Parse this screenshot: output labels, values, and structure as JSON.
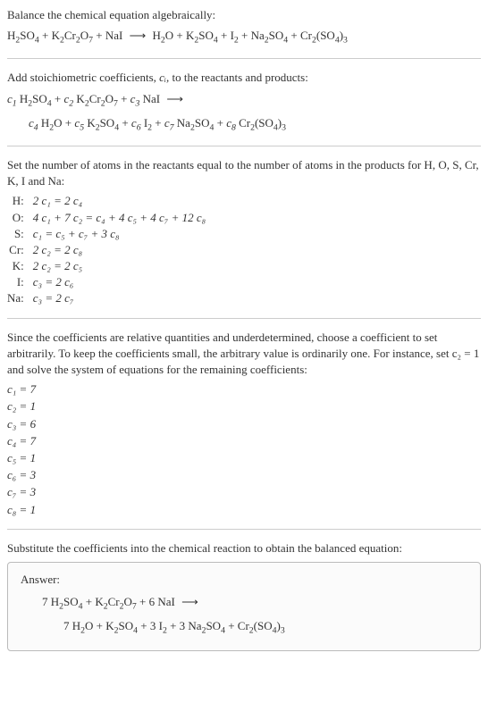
{
  "intro": {
    "line1": "Balance the chemical equation algebraically:"
  },
  "reaction": {
    "lhs": [
      "H₂SO₄",
      "K₂Cr₂O₇",
      "NaI"
    ],
    "rhs": [
      "H₂O",
      "K₂SO₄",
      "I₂",
      "Na₂SO₄",
      "Cr₂(SO₄)₃"
    ]
  },
  "stoich": {
    "text": "Add stoichiometric coefficients, ",
    "text2": ", to the reactants and products:"
  },
  "atoms": {
    "intro": "Set the number of atoms in the reactants equal to the number of atoms in the products for H, O, S, Cr, K, I and Na:",
    "rows": [
      {
        "el": "H:",
        "eq": "2 c₁ = 2 c₄"
      },
      {
        "el": "O:",
        "eq": "4 c₁ + 7 c₂ = c₄ + 4 c₅ + 4 c₇ + 12 c₈"
      },
      {
        "el": "S:",
        "eq": "c₁ = c₅ + c₇ + 3 c₈"
      },
      {
        "el": "Cr:",
        "eq": "2 c₂ = 2 c₈"
      },
      {
        "el": "K:",
        "eq": "2 c₂ = 2 c₅"
      },
      {
        "el": "I:",
        "eq": "c₃ = 2 c₆"
      },
      {
        "el": "Na:",
        "eq": "c₃ = 2 c₇"
      }
    ]
  },
  "underdetermined": {
    "text": "Since the coefficients are relative quantities and underdetermined, choose a coefficient to set arbitrarily. To keep the coefficients small, the arbitrary value is ordinarily one. For instance, set c₂ = 1 and solve the system of equations for the remaining coefficients:"
  },
  "coeffs": [
    {
      "name": "c₁",
      "val": "7"
    },
    {
      "name": "c₂",
      "val": "1"
    },
    {
      "name": "c₃",
      "val": "6"
    },
    {
      "name": "c₄",
      "val": "7"
    },
    {
      "name": "c₅",
      "val": "1"
    },
    {
      "name": "c₆",
      "val": "3"
    },
    {
      "name": "c₇",
      "val": "3"
    },
    {
      "name": "c₈",
      "val": "1"
    }
  ],
  "substitute": {
    "text": "Substitute the coefficients into the chemical reaction to obtain the balanced equation:"
  },
  "answer": {
    "title": "Answer:",
    "lhs_coeffs": [
      "7",
      "",
      "6"
    ],
    "rhs_coeffs": [
      "7",
      "",
      "3",
      "3",
      ""
    ]
  },
  "ci_label": "cᵢ",
  "arrow": "⟶",
  "plus": " + "
}
